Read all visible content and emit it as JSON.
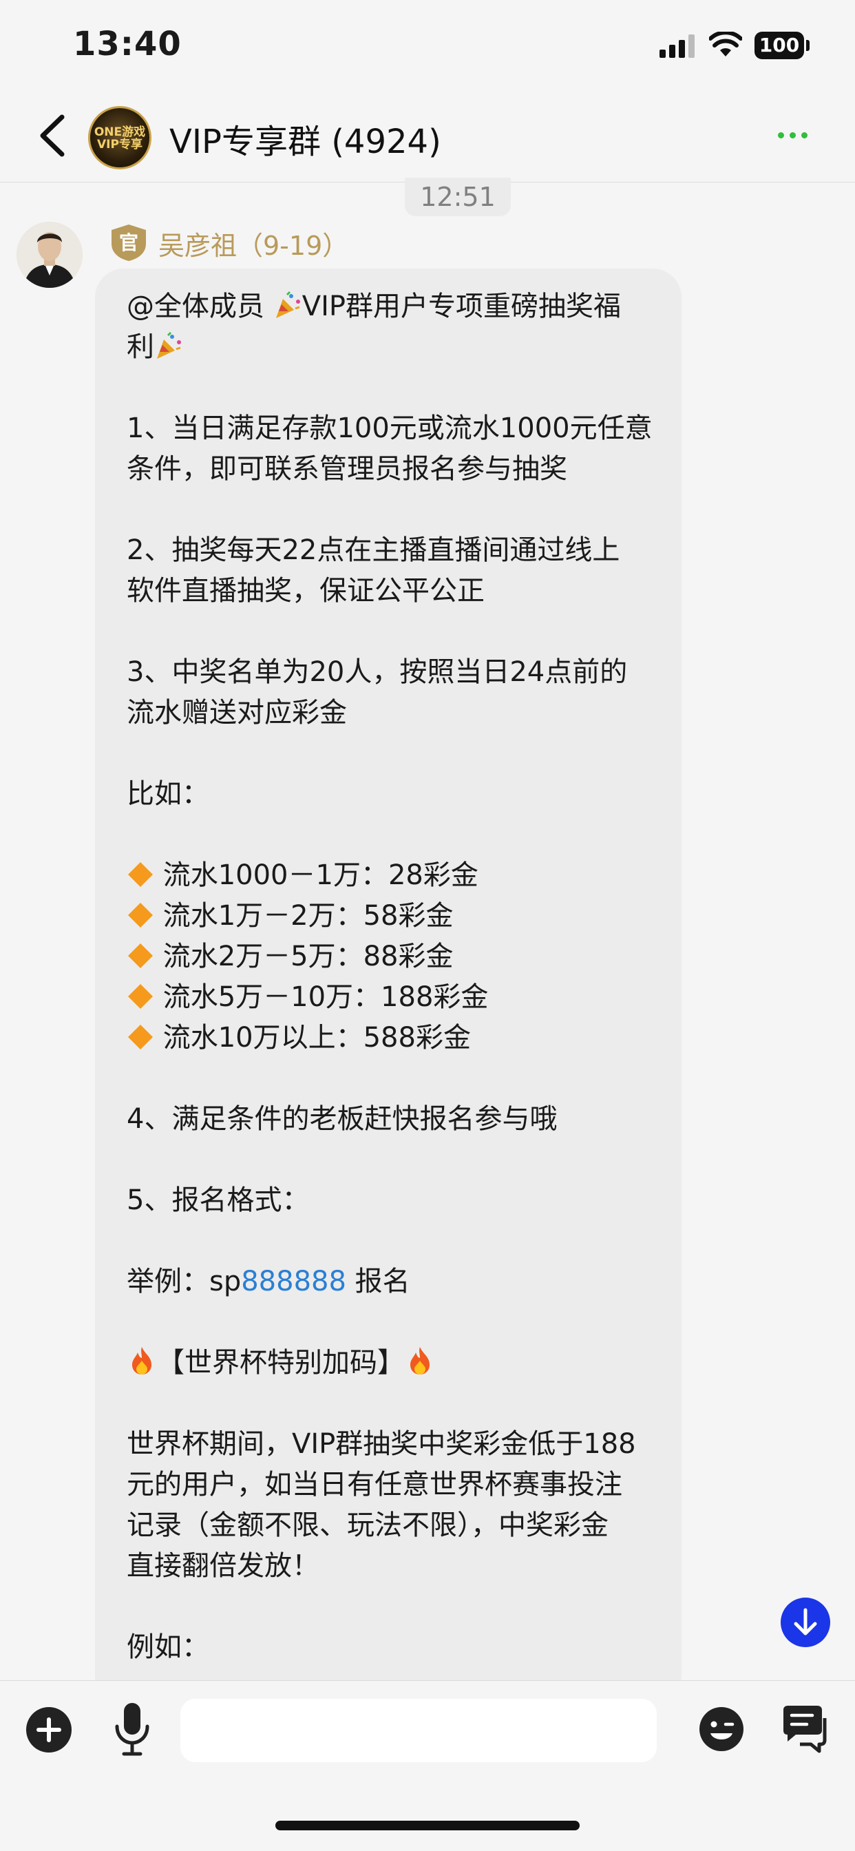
{
  "status_bar": {
    "time": "13:40",
    "battery": "100"
  },
  "nav": {
    "title": "VIP专享群 (4924)",
    "avatar_text_top": "ONE游戏",
    "avatar_text_bottom": "VIP专享"
  },
  "chat": {
    "timestamp": "12:51"
  },
  "message": {
    "sender_badge": "官",
    "sender_name": "吴彦祖（9-19）",
    "lines": {
      "l1": "@全体成员 ",
      "l1b": "VIP群用户专项重磅抽奖福",
      "l2": "利",
      "p1a": "1、当日满足存款100元或流水1000元任意",
      "p1b": "条件，即可联系管理员报名参与抽奖",
      "p2a": "2、抽奖每天22点在主播直播间通过线上",
      "p2b": "软件直播抽奖，保证公平公正",
      "p3a": "3、中奖名单为20人，按照当日24点前的",
      "p3b": "流水赠送对应彩金",
      "p4": "比如：",
      "t1": " 流水1000－1万：28彩金",
      "t2": " 流水1万－2万：58彩金",
      "t3": " 流水2万－5万：88彩金",
      "t4": " 流水5万－10万：188彩金",
      "t5": " 流水10万以上：588彩金",
      "p5": "4、满足条件的老板赶快报名参与哦",
      "p6": "5、报名格式：",
      "p7a": "举例：sp",
      "p7link": "888888",
      "p7b": " 报名",
      "p8": "【世界杯特别加码】",
      "p9a": "世界杯期间，VIP群抽奖中奖彩金低于188",
      "p9b": "元的用户，如当日有任意世界杯赛事投注",
      "p9c": "记录（金额不限、玩法不限），中奖彩金",
      "p9d": "直接翻倍发放！",
      "p10": "例如："
    }
  },
  "input": {
    "placeholder": ""
  },
  "colors": {
    "link": "#2a7fd4",
    "sender_name": "#b89a5a",
    "more_dots": "#2fbf3a",
    "scroll_button": "#1b35e8"
  }
}
